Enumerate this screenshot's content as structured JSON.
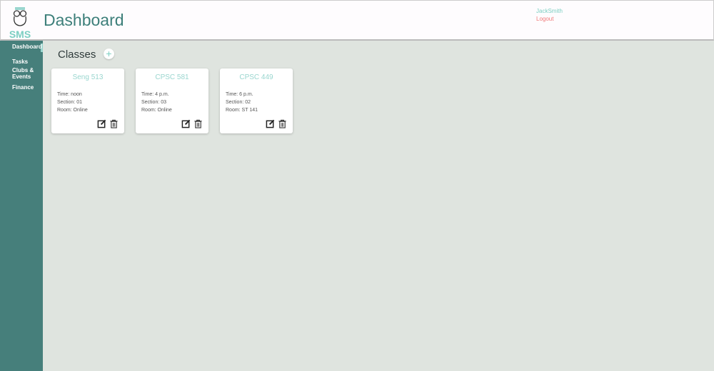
{
  "header": {
    "logo": "SMS",
    "title": "Dashboard",
    "user": "JackSmith",
    "logout": "Logout"
  },
  "sidebar": {
    "items": [
      {
        "label": "Dashboard"
      },
      {
        "label": "Tasks"
      },
      {
        "label": "Clubs & Events"
      },
      {
        "label": "Finance"
      }
    ]
  },
  "main": {
    "heading": "Classes",
    "add_label": "+",
    "classes": [
      {
        "name": "Seng 513",
        "time": "Time: noon",
        "section": "Section: 01",
        "room": "Room: Online"
      },
      {
        "name": "CPSC 581",
        "time": "Time: 4 p.m.",
        "section": "Section: 03",
        "room": "Room: Online"
      },
      {
        "name": "CPSC 449",
        "time": "Time: 6 p.m.",
        "section": "Section: 02",
        "room": "Room: ST 141"
      }
    ]
  }
}
